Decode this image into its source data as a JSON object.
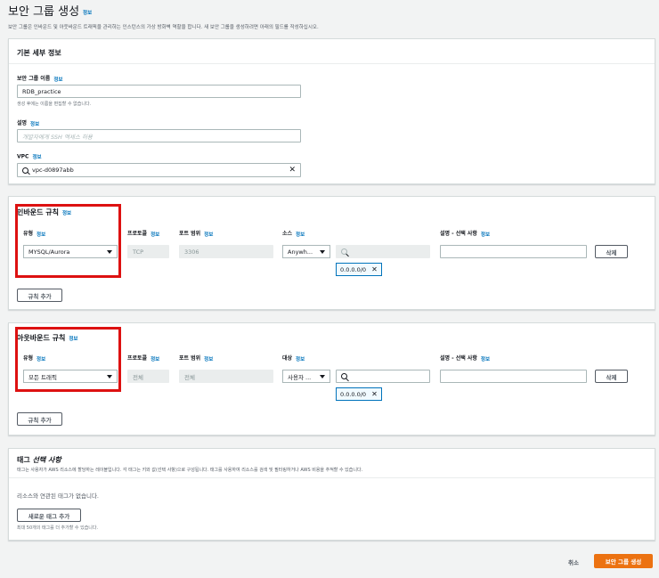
{
  "page": {
    "title": "보안 그룹 생성",
    "info": "정보",
    "description": "보안 그룹은 인바운드 및 아웃바운드 트래픽을 관리하는 인스턴스의 가상 방화벽 역할을 합니다. 새 보안 그룹을 생성하려면 아래의 필드를 작성하십시오."
  },
  "basic": {
    "header": "기본 세부 정보",
    "name_label": "보안 그룹 이름",
    "name_info": "정보",
    "name_value": "RDB_practice",
    "name_hint": "생성 후에는 이름을 편집할 수 없습니다.",
    "desc_label": "설명",
    "desc_info": "정보",
    "desc_placeholder": "개발자에게 SSH 액세스 허용",
    "vpc_label": "VPC",
    "vpc_info": "정보",
    "vpc_value": "vpc-d0897abb"
  },
  "inbound": {
    "title": "인바운드 규칙",
    "info": "정보",
    "cols": {
      "type": "유형",
      "type_info": "정보",
      "protocol": "프로토콜",
      "protocol_info": "정보",
      "port": "포트 범위",
      "port_info": "정보",
      "source": "소스",
      "source_info": "정보",
      "desc": "설명 - 선택 사항",
      "desc_info": "정보"
    },
    "row": {
      "type": "MYSQL/Aurora",
      "protocol": "TCP",
      "port": "3306",
      "source": "Anywh...",
      "token": "0.0.0.0/0",
      "delete": "삭제"
    },
    "add": "규칙 추가"
  },
  "outbound": {
    "title": "아웃바운드 규칙",
    "info": "정보",
    "cols": {
      "type": "유형",
      "type_info": "정보",
      "protocol": "프로토콜",
      "protocol_info": "정보",
      "port": "포트 범위",
      "port_info": "정보",
      "dest": "대상",
      "dest_info": "정보",
      "desc": "설명 - 선택 사항",
      "desc_info": "정보"
    },
    "row": {
      "type": "모든 트래픽",
      "protocol": "전체",
      "port": "전체",
      "dest": "사용자 ...",
      "token": "0.0.0.0/0",
      "delete": "삭제"
    },
    "add": "규칙 추가"
  },
  "tags": {
    "title": "태그 선택 사항",
    "title_main": "태그 ",
    "title_optional": "선택 사항",
    "description": "태그는 사용자가 AWS 리소스에 할당하는 레이블입니다. 각 태그는 키와 값(선택 사항)으로 구성됩니다. 태그를 사용하여 리소스를 검색 및 필터링하거나 AWS 비용을 추적할 수 있습니다.",
    "empty": "리소스와 연관된 태그가 없습니다.",
    "add": "새로운 태그 추가",
    "hint": "최대 50개의 태그를 더 추가할 수 있습니다."
  },
  "footer": {
    "cancel": "취소",
    "create": "보안 그룹 생성"
  },
  "colors": {
    "accent": "#ec7211",
    "link": "#0073bb",
    "highlight": "#dd1111"
  }
}
